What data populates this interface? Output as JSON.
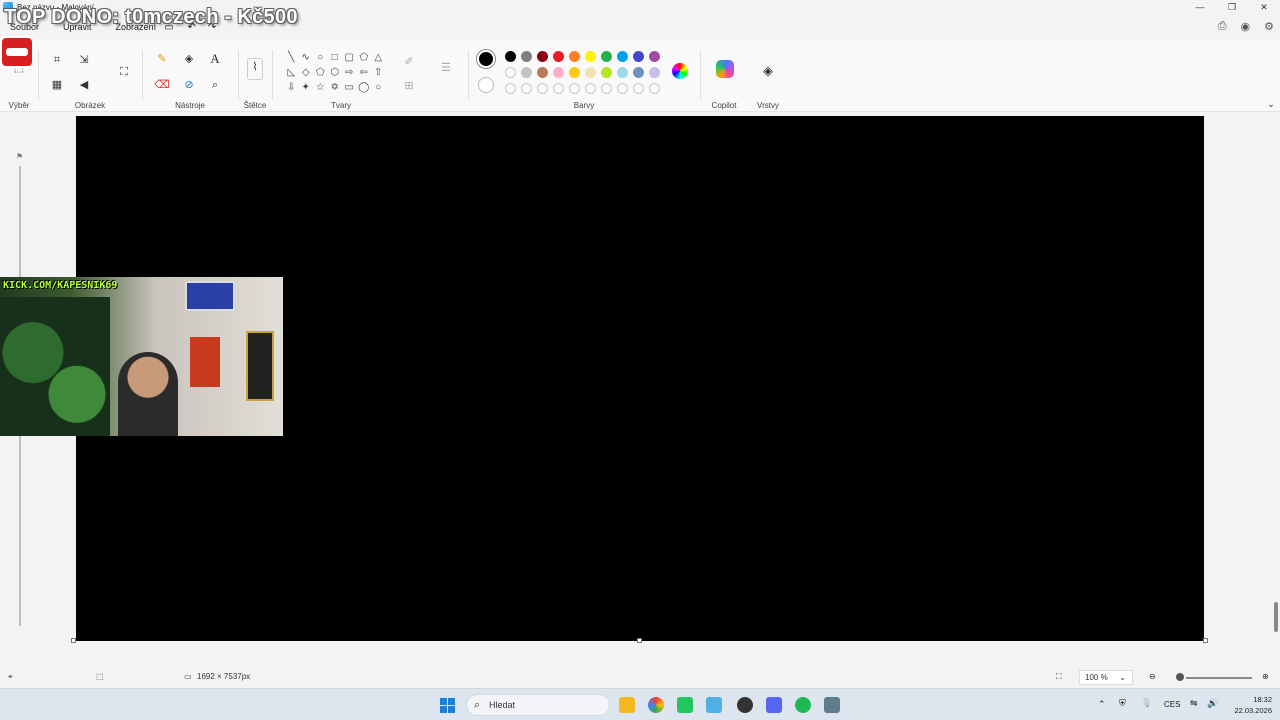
{
  "window": {
    "title": "Bez názvu - Malování"
  },
  "overlay": {
    "top_dono": "TOP DONO: t0mczech - Kč500",
    "webcam_banner": "KICK.COM/KAPESNIK69"
  },
  "menu": {
    "items": [
      "Soubor",
      "Upravit",
      "Zobrazení"
    ]
  },
  "ribbon": {
    "groups": {
      "selection": "Výběr",
      "image": "Obrázek",
      "tools": "Nástroje",
      "brushes": "Štětce",
      "shapes": "Tvary",
      "colors": "Barvy",
      "copilot": "Copilot",
      "layers": "Vrstvy"
    },
    "palette_row1": [
      "#000000",
      "#7f7f7f",
      "#880015",
      "#ed1c24",
      "#ff7f27",
      "#fff200",
      "#22b14c",
      "#00a2e8",
      "#3f48cc",
      "#a349a4"
    ],
    "palette_row2": [
      "",
      "#c3c3c3",
      "#b97a57",
      "#ffaec9",
      "#ffc90e",
      "#efe4b0",
      "#b5e61d",
      "#99d9ea",
      "#7092be",
      "#c8bfe7"
    ],
    "primary_color": "#000000",
    "secondary_color": "#ffffff"
  },
  "status": {
    "image_size": "1692 × 7537px",
    "zoom": "100 %"
  },
  "taskbar": {
    "search_placeholder": "Hledat",
    "language": "CES",
    "time": "18:32",
    "date": "22.03.2026"
  }
}
